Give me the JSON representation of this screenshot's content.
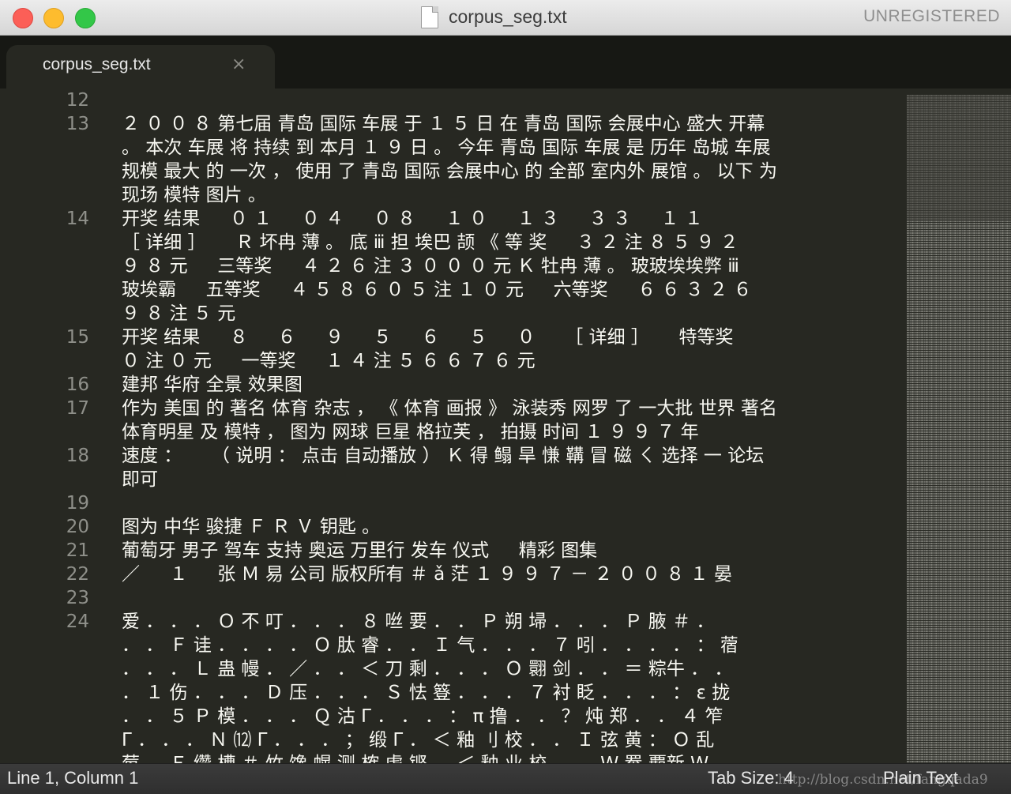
{
  "window": {
    "title": "corpus_seg.txt",
    "registration": "UNREGISTERED"
  },
  "tab": {
    "label": "corpus_seg.txt",
    "close_glyph": "×"
  },
  "editor": {
    "rows": [
      {
        "n": "12",
        "text": ""
      },
      {
        "n": "13",
        "text": " ２ ０ ０ ８ 第七届 青岛 国际 车展 于 １ ５ 日 在 青岛 国际 会展中心 盛大 开幕"
      },
      {
        "n": "",
        "text": "。 本次 车展 将 持续 到 本月 １ ９ 日 。 今年 青岛 国际 车展 是 历年 岛城 车展"
      },
      {
        "n": "",
        "text": "规模 最大 的 一次 ， 使用 了 青岛 国际 会展中心 的 全部 室内外 展馆 。 以下 为"
      },
      {
        "n": "",
        "text": "现场 模特 图片 。"
      },
      {
        "n": "14",
        "text": "开奖 结果 　 ０ １ 　 ０ ４ 　 ０ ８ 　 １ ０ 　 １ ３ 　 ３ ３ 　 １ １"
      },
      {
        "n": "",
        "text": " ［ 详细 ］ 　 Ｒ 坏冉 薄 。 底 ⅲ 担 埃巴 颉 《 等 奖 　 ３ ２ 注 ８ ５ ９ ２"
      },
      {
        "n": "",
        "text": "９ ８ 元 　 三等奖 　 ４ ２ ６ 注 ３ ０ ０ ０ 元 Ｋ 牡冉 薄 。 玻玻埃埃弊 ⅲ"
      },
      {
        "n": "",
        "text": "玻埃霸 　 五等奖 　 ４ ５ ８ ６ ０ ５ 注 １ ０ 元 　 六等奖 　 ６ ６ ３ ２ ６"
      },
      {
        "n": "",
        "text": "９ ８ 注 ５ 元"
      },
      {
        "n": "15",
        "text": "开奖 结果 　 ８ 　 ６ 　 ９ 　 ５ 　 ６ 　 ５ 　 ０ 　 ［ 详细 ］ 　 特等奖"
      },
      {
        "n": "",
        "text": "０ 注 ０ 元 　 一等奖 　 １ ４ 注 ５ ６ ６ ７ ６ 元"
      },
      {
        "n": "16",
        "text": "建邦 华府 全景 效果图"
      },
      {
        "n": "17",
        "text": "作为 美国 的 著名 体育 杂志 ， 《 体育 画报 》 泳装秀 网罗 了 一大批 世界 著名"
      },
      {
        "n": "",
        "text": "体育明星 及 模特 ， 图为 网球 巨星 格拉芙 ， 拍摄 时间 １ ９ ９ ７ 年"
      },
      {
        "n": "18",
        "text": "速度 ： 　 （ 说明 ： 点击 自动播放 ） Ｋ 得 鳎 旱 慊 鞲 冒 磁 ㄑ 选择 一 论坛"
      },
      {
        "n": "",
        "text": "即可"
      },
      {
        "n": "19",
        "text": ""
      },
      {
        "n": "20",
        "text": "图为 中华 骏捷 Ｆ Ｒ Ｖ 钥匙 。"
      },
      {
        "n": "21",
        "text": "葡萄牙 男子 驾车 支持 奥运 万里行 发车 仪式 　 精彩 图集"
      },
      {
        "n": "22",
        "text": " ／ 　 １ 　 张 Ｍ 易 公司 版权所有 ＃ ǎ 茫 １ ９ ９ ７ － ２ ０ ０ ８ １ 晏"
      },
      {
        "n": "23",
        "text": ""
      },
      {
        "n": "24",
        "text": "爱 ． ． ． Ｏ 不 叮 ． ． ． ８ 咝 要 ． ． Ｐ 朔 埽 ． ． ． Ｐ 腋 ＃ ．"
      },
      {
        "n": "",
        "text": "． ． Ｆ 诖 ． ． ． ． Ｏ 肽 睿 ． ． Ｉ 气 ． ． ． ７ 吲 ． ． ． ． ： 蓿"
      },
      {
        "n": "",
        "text": "． ． ． Ｌ 蛊 幔 ． ／ ． ． ＜ 刀 剩 ． ． ． Ｏ 翾 剑 ． ． ＝ 粽牛 ． ．"
      },
      {
        "n": "",
        "text": "． １ 伤 ． ． ． Ｄ 压 ． ． ． Ｓ 怯 簦 ． ． ． ７ 衬 眨 ． ． ． ： ε 拢"
      },
      {
        "n": "",
        "text": "． ． ５ Ｐ 模 ． ． ． Ｑ 沽 Γ ． ． ． ： π 撸 ． ． ？ 炖 郑 ． ． ４ 笮"
      },
      {
        "n": "",
        "text": "Γ ． ． ． Ｎ ⑿ Γ ． ． ． ； 缎 Γ ． ＜ 釉 刂 校 ． ． Ｉ 弦 黄 ： Ｏ 乱"
      },
      {
        "n": "",
        "text": "莓 ． Ｅ 缵 槽 ＃ 竹 馋 幌 测 榷 虐 铿 ． ＜ 釉 业 校 ． ． Ｗ 罨 覇新 Ｗ"
      }
    ]
  },
  "status": {
    "position": "Line 1, Column 1",
    "tab_size": "Tab Size: 4",
    "syntax": "Plain Text",
    "watermark": "http://blog.csdn.net/fangqada9"
  }
}
